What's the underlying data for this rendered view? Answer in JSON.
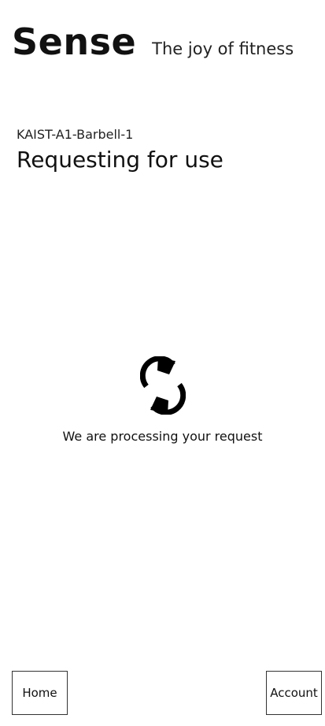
{
  "header": {
    "brand": "Sense",
    "tagline": "The joy of fitness"
  },
  "device": {
    "id": "KAIST-A1-Barbell-1"
  },
  "page": {
    "title": "Requesting for use"
  },
  "status": {
    "icon": "sync-icon",
    "message": "We are processing your request"
  },
  "nav": {
    "home_label": "Home",
    "account_label": "Account"
  }
}
